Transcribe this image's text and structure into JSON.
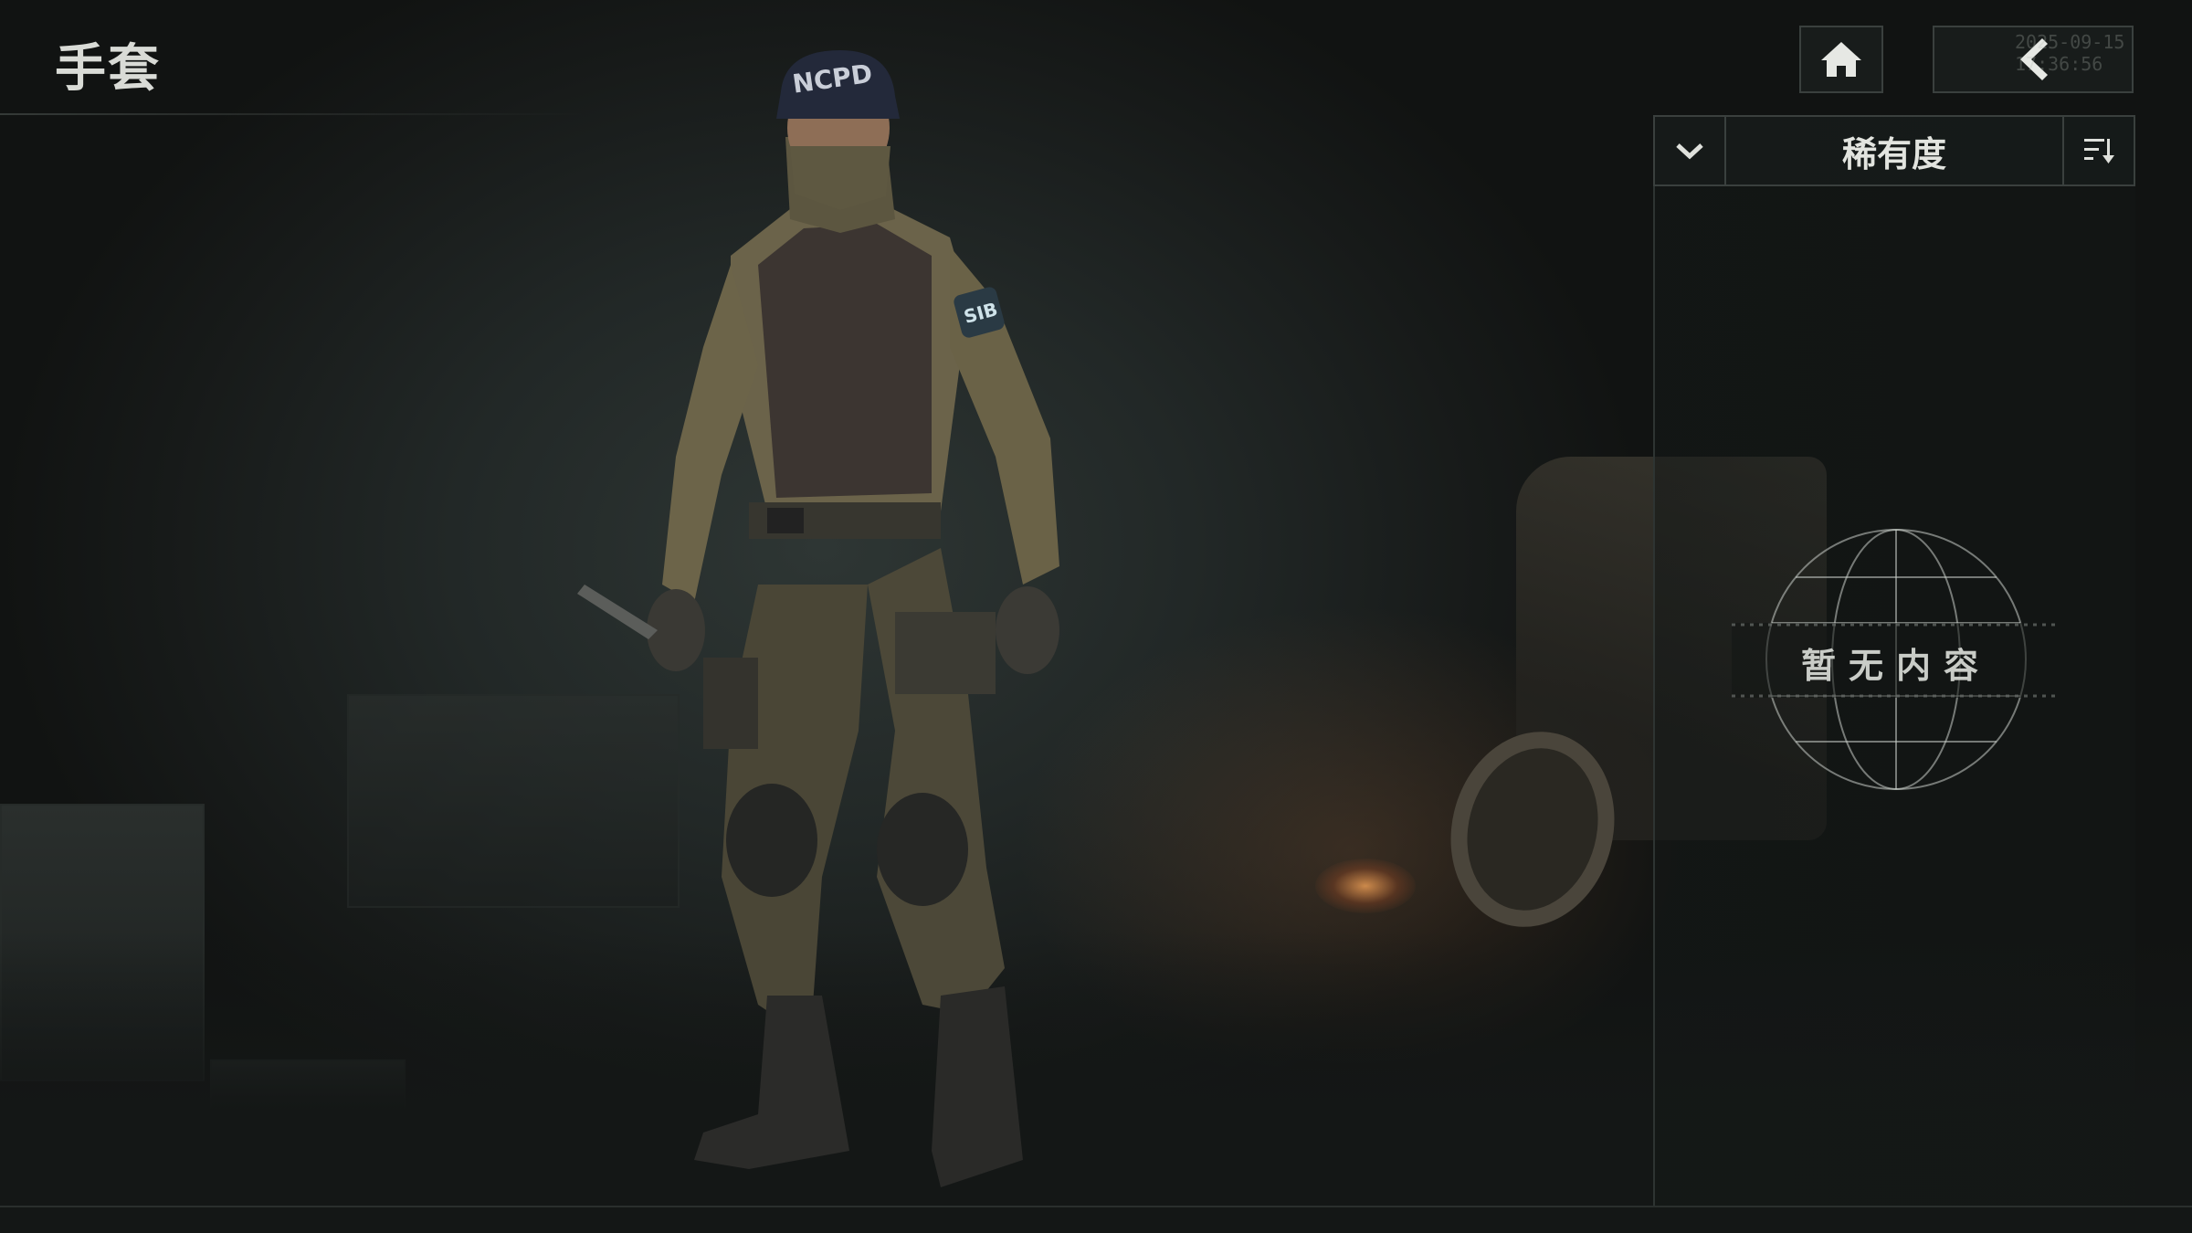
{
  "header": {
    "title": "手套",
    "timestamp": "2025-09-15 17:36:56"
  },
  "nav": {
    "home_icon": "home-icon",
    "back_icon": "chevron-left-icon"
  },
  "sort": {
    "label": "稀有度",
    "toggle_icon": "chevron-down-icon",
    "order_icon": "sort-order-icon"
  },
  "inventory": {
    "empty_message": "暂无内容"
  },
  "character": {
    "cap_text": "NCPD",
    "patch_text": "SIB"
  },
  "colors": {
    "text_primary": "#d9dbd6",
    "panel_border": "#3a403e",
    "panel_bg": "#161a19",
    "accent_glow": "#ffaa5a"
  }
}
